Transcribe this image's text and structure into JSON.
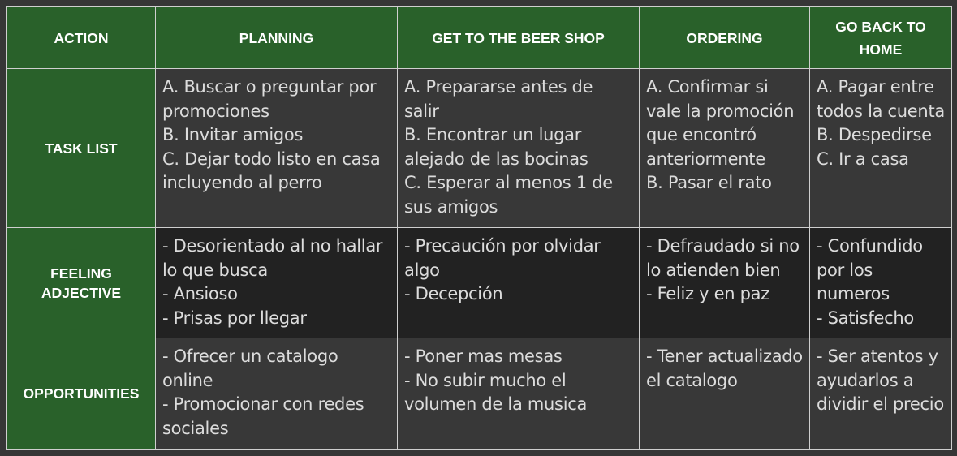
{
  "colors": {
    "header_green": "#29612a",
    "cell_bg": "#383838",
    "cell_bg_dark": "#222222",
    "text": "#dcdcdc",
    "header_text": "#ffffff",
    "border": "#cfcfcf"
  },
  "header": {
    "action": "ACTION",
    "stages": [
      "PLANNING",
      "GET TO THE BEER SHOP",
      "ORDERING",
      "GO BACK TO HOME"
    ]
  },
  "rows": [
    {
      "label": "TASK LIST",
      "cells": [
        "A. Buscar o preguntar por promociones\nB. Invitar amigos\nC. Dejar todo listo en casa incluyendo al perro",
        "A. Prepararse antes de salir\nB. Encontrar un lugar alejado de las bocinas\nC. Esperar al menos 1 de sus amigos",
        "A. Confirmar si vale la promoción que encontró anteriormente\nB. Pasar el rato",
        "A. Pagar entre todos la cuenta\nB. Despedirse\nC. Ir a casa"
      ]
    },
    {
      "label": "FEELING ADJECTIVE",
      "cells": [
        "- Desorientado al no hallar lo que busca\n- Ansioso\n- Prisas por llegar",
        "- Precaución por olvidar algo\n- Decepción",
        "- Defraudado si no lo atienden bien\n- Feliz y en paz",
        "- Confundido por los numeros\n- Satisfecho"
      ]
    },
    {
      "label": "OPPORTUNITIES",
      "cells": [
        "- Ofrecer un catalogo online\n- Promocionar con redes sociales",
        "- Poner mas mesas\n- No subir mucho el volumen de la musica",
        "- Tener actualizado el catalogo",
        "- Ser atentos y ayudarlos a dividir el precio"
      ]
    }
  ]
}
